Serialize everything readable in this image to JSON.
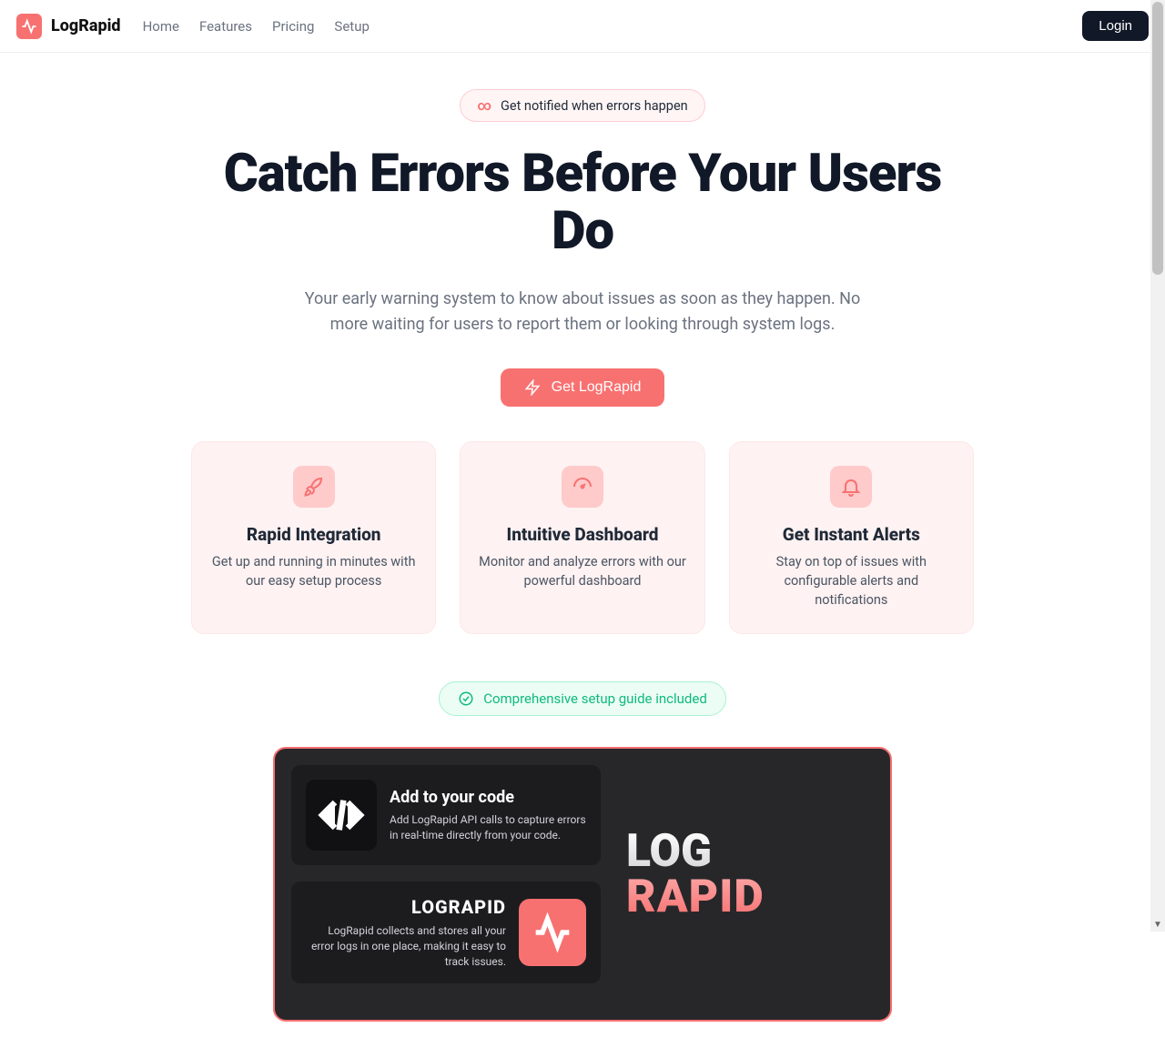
{
  "nav": {
    "brand": "LogRapid",
    "links": [
      "Home",
      "Features",
      "Pricing",
      "Setup"
    ],
    "login": "Login"
  },
  "hero": {
    "pill_text": "Get notified when errors happen",
    "title": "Catch Errors Before Your Users Do",
    "subtitle": "Your early warning system to know about issues as soon as they happen. No more waiting for users to report them or looking through system logs.",
    "cta": "Get LogRapid"
  },
  "features": [
    {
      "title": "Rapid Integration",
      "desc": "Get up and running in minutes with our easy setup process"
    },
    {
      "title": "Intuitive Dashboard",
      "desc": "Monitor and analyze errors with our powerful dashboard"
    },
    {
      "title": "Get Instant Alerts",
      "desc": "Stay on top of issues with configurable alerts and notifications"
    }
  ],
  "green_pill": "Comprehensive setup guide included",
  "dark": {
    "card1_title": "Add to your code",
    "card1_desc": "Add LogRapid API calls to capture errors in real-time directly from your code.",
    "card2_title": "LOGRAPID",
    "card2_desc": "LogRapid collects and stores all your error logs in one place, making it easy to track issues.",
    "big1": "LOG",
    "big2": "RAPID"
  }
}
